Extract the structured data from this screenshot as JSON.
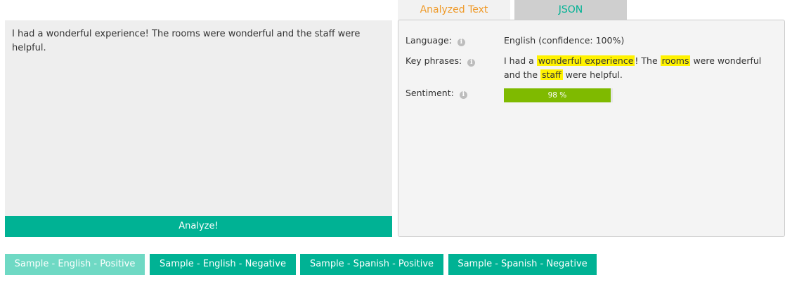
{
  "input": {
    "text": "I had a wonderful experience! The rooms were wonderful and the staff were helpful."
  },
  "analyze_button": {
    "label": "Analyze!"
  },
  "tabs": [
    {
      "label": "Analyzed Text",
      "active": true
    },
    {
      "label": "JSON",
      "active": false
    }
  ],
  "results": {
    "language": {
      "label": "Language:",
      "value": "English (confidence: 100%)"
    },
    "key_phrases": {
      "label": "Key phrases:",
      "segments": [
        {
          "text": "I had a ",
          "highlight": false
        },
        {
          "text": "wonderful experience",
          "highlight": true
        },
        {
          "text": "! The ",
          "highlight": false
        },
        {
          "text": "rooms",
          "highlight": true
        },
        {
          "text": " were wonderful and the ",
          "highlight": false
        },
        {
          "text": "staff",
          "highlight": true
        },
        {
          "text": " were helpful.",
          "highlight": false
        }
      ]
    },
    "sentiment": {
      "label": "Sentiment:",
      "percent": 98,
      "display": "98 %"
    },
    "info_icon": "info-icon"
  },
  "samples": [
    {
      "label": "Sample - English - Positive",
      "active": true
    },
    {
      "label": "Sample - English - Negative",
      "active": false
    },
    {
      "label": "Sample - Spanish - Positive",
      "active": false
    },
    {
      "label": "Sample - Spanish - Negative",
      "active": false
    }
  ],
  "colors": {
    "accent": "#00b294",
    "accent_light": "#6fd9c4",
    "tab_active_text": "#ef9a29",
    "highlight": "#fff200",
    "sentiment_positive": "#7fba00"
  }
}
